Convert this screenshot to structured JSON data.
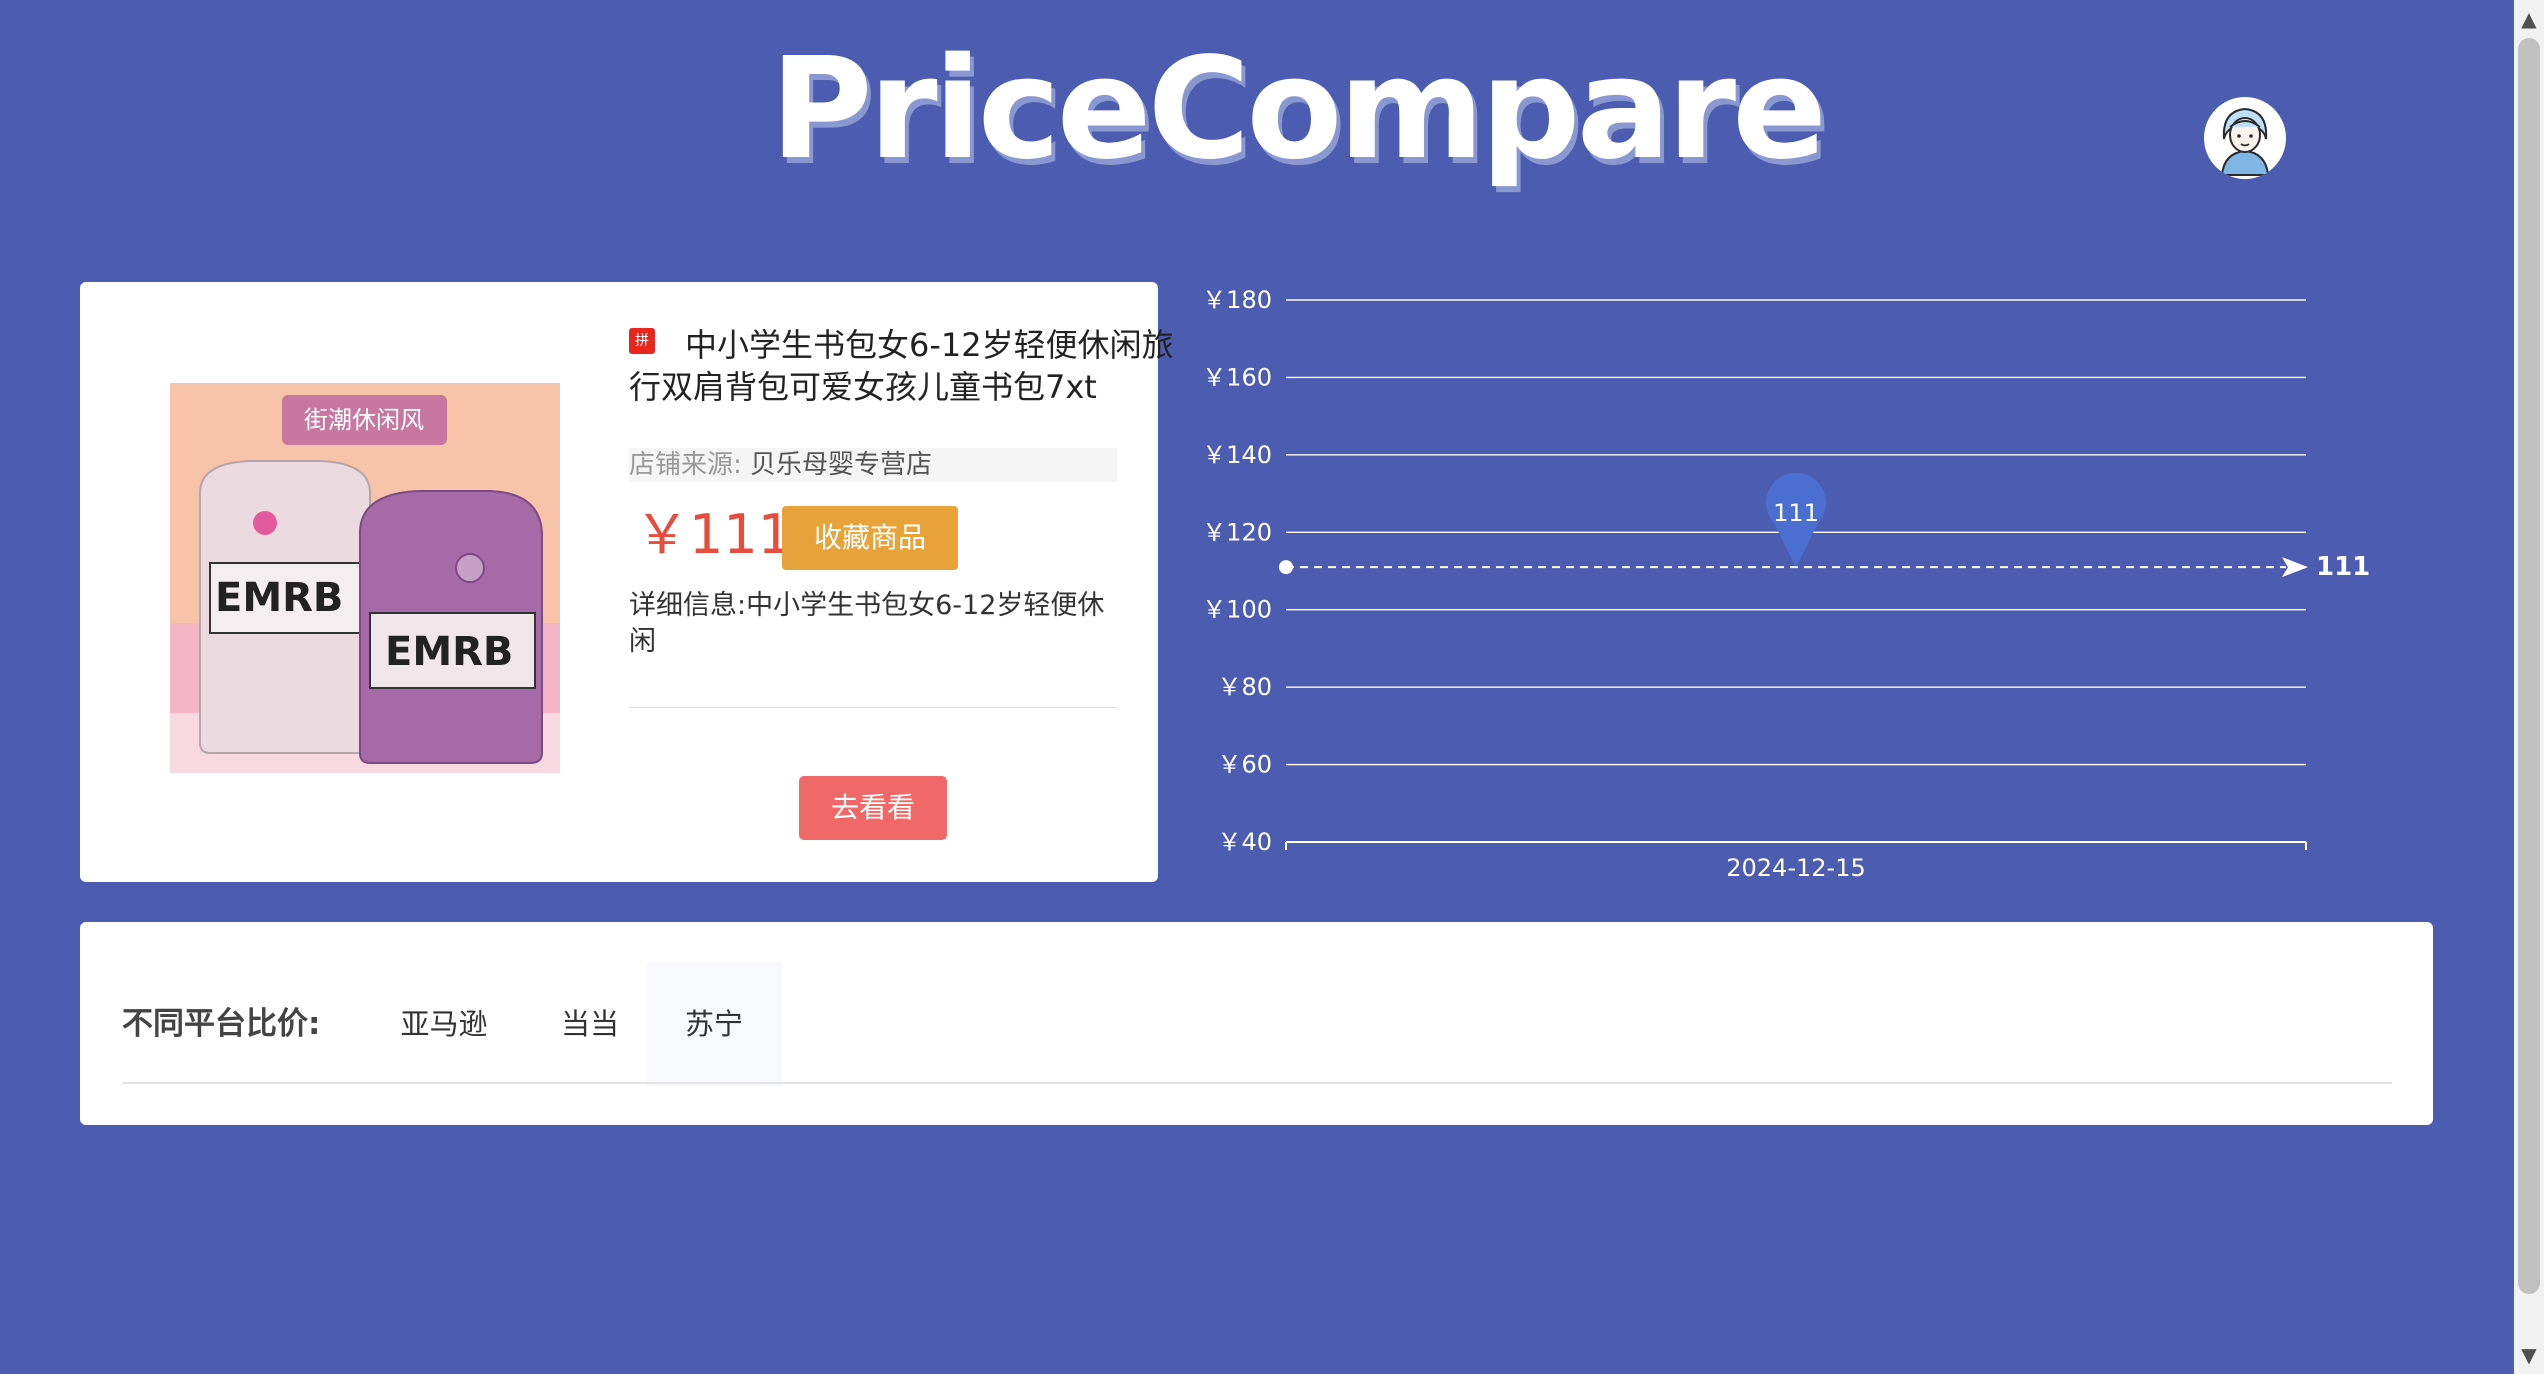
{
  "header": {
    "logo_text": "PriceCompare",
    "avatar_icon": "user-avatar-icon"
  },
  "product": {
    "platform_icon": "pinduoduo-icon",
    "platform_icon_glyph": "拼",
    "title": "中小学生书包女6-12岁轻便休闲旅行双肩背包可爱女孩儿童书包7xt",
    "shop_label": "店铺来源:",
    "shop_name": "贝乐母婴专营店",
    "price": "￥111",
    "favorite_label": "收藏商品",
    "detail": "详细信息:中小学生书包女6-12岁轻便休闲",
    "go_label": "去看看",
    "image_badge": "街潮休闲风",
    "image_brand": "EMRB"
  },
  "chart_data": {
    "type": "line",
    "x": [
      "2024-12-15"
    ],
    "series": [
      {
        "values": [
          111
        ]
      }
    ],
    "yticks": [
      "￥180",
      "￥160",
      "￥140",
      "￥120",
      "￥100",
      "￥80",
      "￥60",
      "￥40"
    ],
    "ylim": [
      40,
      180
    ],
    "point_label": "111",
    "mark_line_label": "111",
    "grid": true,
    "color": "#ffffff"
  },
  "compare": {
    "label": "不同平台比价:",
    "platforms": [
      "亚马逊",
      "当当",
      "苏宁"
    ],
    "active_index": 2
  },
  "colors": {
    "background": "#4c5db1",
    "price": "#e74c3c",
    "favorite_button": "#e8a23a",
    "go_button": "#f06868",
    "pin": "#4a6fd0"
  }
}
